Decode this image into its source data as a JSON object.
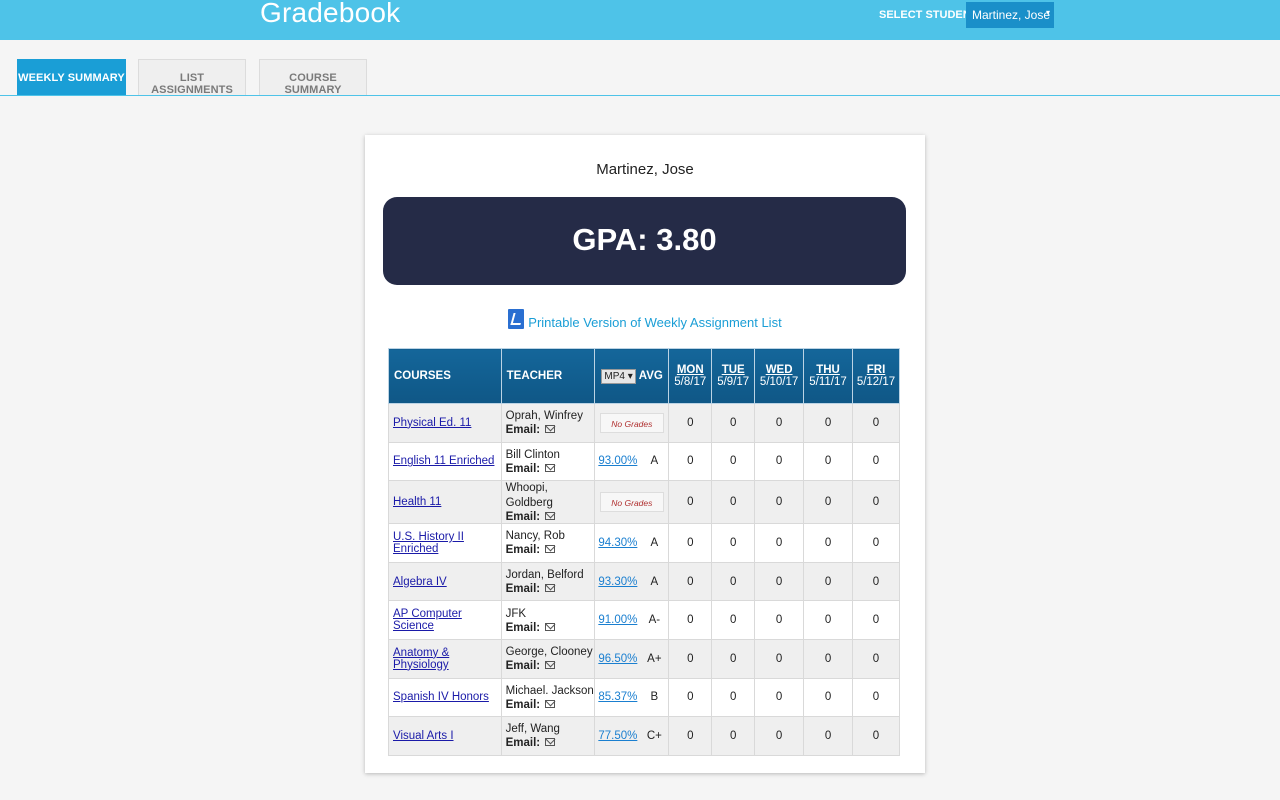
{
  "app": {
    "title": "Gradebook"
  },
  "header": {
    "select_label": "SELECT STUDENT:",
    "selected_student": "Martinez, Jose",
    "select_caret": "▾"
  },
  "tabs": [
    {
      "label": "WEEKLY SUMMARY",
      "active": true
    },
    {
      "label": "LIST ASSIGNMENTS",
      "active": false
    },
    {
      "label": "COURSE SUMMARY",
      "active": false
    }
  ],
  "summary": {
    "student_name": "Martinez, Jose",
    "gpa_text": "GPA: 3.80",
    "print_link": "Printable Version of Weekly Assignment List"
  },
  "table": {
    "headers": {
      "courses": "COURSES",
      "teacher": "TEACHER",
      "mp": "MP4",
      "mp_caret": "▾",
      "avg": "AVG"
    },
    "days": [
      {
        "day": "MON",
        "date": "5/8/17"
      },
      {
        "day": "TUE",
        "date": "5/9/17"
      },
      {
        "day": "WED",
        "date": "5/10/17"
      },
      {
        "day": "THU",
        "date": "5/11/17"
      },
      {
        "day": "FRI",
        "date": "5/12/17"
      }
    ],
    "email_label": "Email:",
    "no_grades_label": "No Grades",
    "rows": [
      {
        "course": "Physical Ed. 11",
        "teacher": "Oprah, Winfrey",
        "avg": "",
        "letter": "",
        "no_grades": true,
        "days": [
          "0",
          "0",
          "0",
          "0",
          "0"
        ]
      },
      {
        "course": "English 11 Enriched",
        "teacher": "Bill Clinton",
        "avg": "93.00%",
        "letter": "A",
        "no_grades": false,
        "days": [
          "0",
          "0",
          "0",
          "0",
          "0"
        ]
      },
      {
        "course": "Health 11",
        "teacher": "Whoopi, Goldberg",
        "avg": "",
        "letter": "",
        "no_grades": true,
        "days": [
          "0",
          "0",
          "0",
          "0",
          "0"
        ]
      },
      {
        "course": "U.S. History II Enriched",
        "teacher": "Nancy, Rob",
        "avg": "94.30%",
        "letter": "A",
        "no_grades": false,
        "days": [
          "0",
          "0",
          "0",
          "0",
          "0"
        ]
      },
      {
        "course": "Algebra IV",
        "teacher": "Jordan, Belford",
        "avg": "93.30%",
        "letter": "A",
        "no_grades": false,
        "days": [
          "0",
          "0",
          "0",
          "0",
          "0"
        ]
      },
      {
        "course": "AP Computer Science",
        "teacher": "JFK",
        "avg": "91.00%",
        "letter": "A-",
        "no_grades": false,
        "days": [
          "0",
          "0",
          "0",
          "0",
          "0"
        ]
      },
      {
        "course": "Anatomy & Physiology",
        "teacher": "George, Clooney",
        "avg": "96.50%",
        "letter": "A+",
        "no_grades": false,
        "days": [
          "0",
          "0",
          "0",
          "0",
          "0"
        ]
      },
      {
        "course": "Spanish IV Honors",
        "teacher": "Michael. Jackson",
        "avg": "85.37%",
        "letter": "B",
        "no_grades": false,
        "days": [
          "0",
          "0",
          "0",
          "0",
          "0"
        ]
      },
      {
        "course": "Visual Arts I",
        "teacher": "Jeff, Wang",
        "avg": "77.50%",
        "letter": "C+",
        "no_grades": false,
        "days": [
          "0",
          "0",
          "0",
          "0",
          "0"
        ]
      }
    ]
  },
  "colors": {
    "topbar": "#4ec3e8",
    "active_tab": "#1a9ed6",
    "gpa_box": "#252b47",
    "table_header": "#14669a"
  }
}
